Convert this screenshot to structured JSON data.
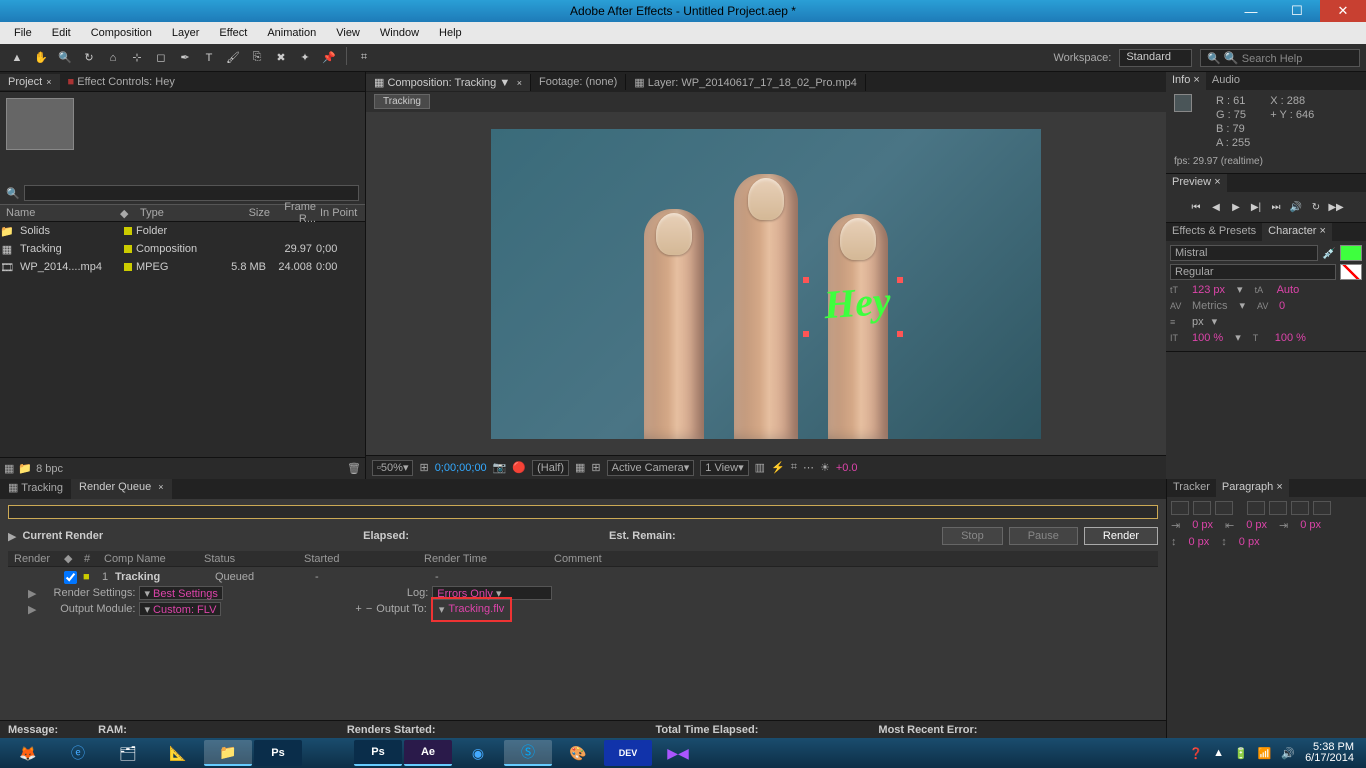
{
  "window": {
    "title": "Adobe After Effects - Untitled Project.aep *"
  },
  "menu": {
    "items": [
      "File",
      "Edit",
      "Composition",
      "Layer",
      "Effect",
      "Animation",
      "View",
      "Window",
      "Help"
    ]
  },
  "toolbar": {
    "workspace_label": "Workspace:",
    "workspace_value": "Standard",
    "search_placeholder": "Search Help"
  },
  "project": {
    "tab_project": "Project",
    "tab_effect_controls": "Effect Controls: Hey",
    "search_icon": "search",
    "columns": {
      "name": "Name",
      "type": "Type",
      "size": "Size",
      "frame_r": "Frame R...",
      "in_point": "In Point"
    },
    "rows": [
      {
        "name": "Solids",
        "type": "Folder",
        "size": "",
        "fr": "",
        "ip": ""
      },
      {
        "name": "Tracking",
        "type": "Composition",
        "size": "",
        "fr": "29.97",
        "ip": "0;00"
      },
      {
        "name": "WP_2014....mp4",
        "type": "MPEG",
        "size": "5.8 MB",
        "fr": "24.008",
        "ip": "0:00"
      }
    ],
    "footer_bpc": "8 bpc"
  },
  "comp": {
    "tab_comp": "Composition: Tracking",
    "tab_footage": "Footage: (none)",
    "tab_layer": "Layer: WP_20140617_17_18_02_Pro.mp4",
    "breadcrumb": "Tracking",
    "overlay_text": "Hey",
    "footer": {
      "zoom": "50%",
      "timecode": "0;00;00;00",
      "resolution": "(Half)",
      "camera": "Active Camera",
      "view": "1 View",
      "exposure": "+0.0"
    }
  },
  "info": {
    "tab_info": "Info",
    "tab_audio": "Audio",
    "r": "R : 61",
    "g": "G : 75",
    "b": "B : 79",
    "a": "A : 255",
    "x": "X : 288",
    "y": "Y : 646",
    "fps": "fps: 29.97 (realtime)"
  },
  "preview": {
    "tab": "Preview"
  },
  "character": {
    "tab_ep": "Effects & Presets",
    "tab_char": "Character",
    "font": "Mistral",
    "style": "Regular",
    "size": "123 px",
    "leading": "Auto",
    "kerning": "Metrics",
    "tracking": "0",
    "stroke_unit": "px",
    "vscale": "100 %",
    "hscale": "100 %"
  },
  "tracker": {
    "tab_tracker": "Tracker",
    "tab_paragraph": "Paragraph",
    "indent_values": [
      "0 px",
      "0 px",
      "0 px",
      "0 px",
      "0 px"
    ]
  },
  "render": {
    "tab_tracking": "Tracking",
    "tab_queue": "Render Queue",
    "current": "Current Render",
    "elapsed_label": "Elapsed:",
    "remain_label": "Est. Remain:",
    "btn_stop": "Stop",
    "btn_pause": "Pause",
    "btn_render": "Render",
    "cols": {
      "render": "Render",
      "num": "#",
      "comp": "Comp Name",
      "status": "Status",
      "started": "Started",
      "rtime": "Render Time",
      "comment": "Comment"
    },
    "item": {
      "num": "1",
      "comp": "Tracking",
      "status": "Queued",
      "started": "-",
      "rtime": "-"
    },
    "settings_label": "Render Settings:",
    "settings_value": "Best Settings",
    "log_label": "Log:",
    "log_value": "Errors Only",
    "output_module_label": "Output Module:",
    "output_module_value": "Custom: FLV",
    "output_to_label": "Output To:",
    "output_to_value": "Tracking.flv",
    "status_bar": {
      "message": "Message:",
      "ram": "RAM:",
      "renders_started": "Renders Started:",
      "total_time": "Total Time Elapsed:",
      "recent_error": "Most Recent Error:"
    }
  },
  "taskbar": {
    "time": "5:38 PM",
    "date": "6/17/2014"
  }
}
